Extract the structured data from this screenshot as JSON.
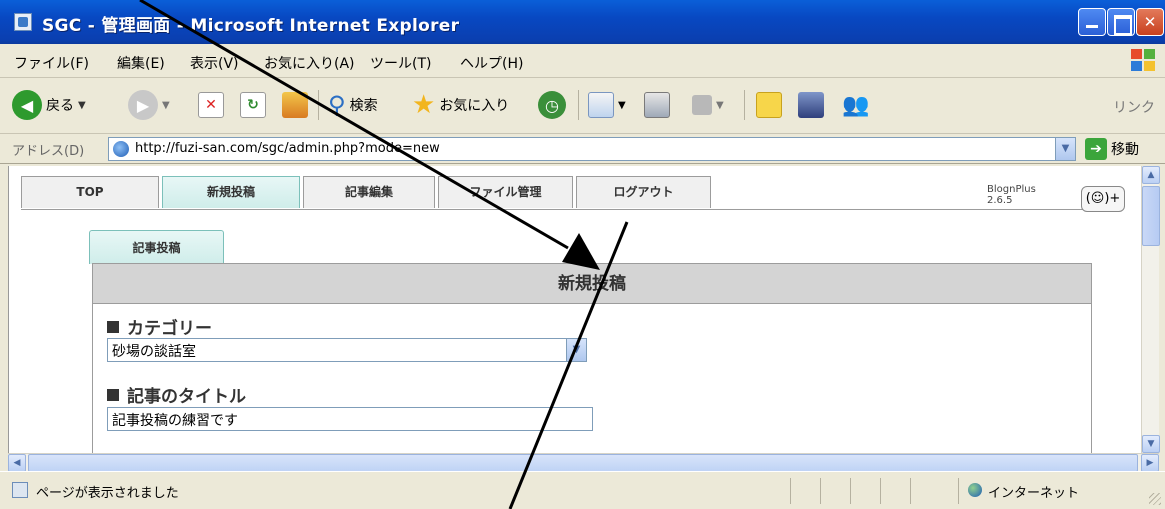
{
  "window": {
    "title": "SGC - 管理画面 - Microsoft Internet Explorer"
  },
  "menu": [
    "ファイル(F)",
    "編集(E)",
    "表示(V)",
    "お気に入り(A)",
    "ツール(T)",
    "ヘルプ(H)"
  ],
  "toolbar": {
    "back_label": "戻る",
    "search_label": "検索",
    "favorites_label": "お気に入り",
    "links_label": "リンク"
  },
  "address": {
    "label": "アドレス(D)",
    "url": "http://fuzi-san.com/sgc/admin.php?mode=new",
    "go_label": "移動"
  },
  "app_tabs": [
    "TOP",
    "新規投稿",
    "記事編集",
    "ファイル管理",
    "ログアウト"
  ],
  "blogn": {
    "name": "BlognPlus",
    "version": "2.6.5",
    "button_symbol": "(☺)+"
  },
  "sub_tab": "記事投稿",
  "form": {
    "header": "新規投稿",
    "category_label": "カテゴリー",
    "category_value": "砂場の談話室",
    "title_label": "記事のタイトル",
    "title_value": "記事投稿の練習です"
  },
  "status": {
    "text": "ページが表示されました",
    "zone": "インターネット"
  },
  "colors": {
    "titlebar": "#0A5FD8",
    "chrome": "#ECE9D8",
    "active_tab": "#CFEDEA",
    "form_header": "#D4D4D4"
  }
}
